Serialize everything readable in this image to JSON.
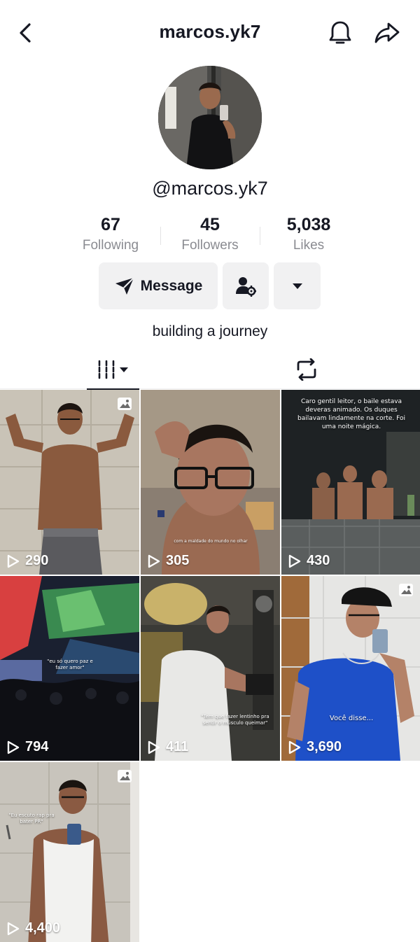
{
  "header": {
    "title": "marcos.yk7",
    "back_icon": "chevron-left-icon",
    "bell_icon": "bell-icon",
    "share_icon": "share-arrow-icon"
  },
  "profile": {
    "handle": "@marcos.yk7",
    "stats": [
      {
        "value": "67",
        "label": "Following"
      },
      {
        "value": "45",
        "label": "Followers"
      },
      {
        "value": "5,038",
        "label": "Likes"
      }
    ],
    "message_label": "Message",
    "bio": "building a journey"
  },
  "tabs": [
    {
      "name": "videos",
      "icon": "grid-icon",
      "active": true
    },
    {
      "name": "reposts",
      "icon": "repost-icon",
      "active": false
    }
  ],
  "videos": [
    {
      "views": "290",
      "photo": true,
      "caption": ""
    },
    {
      "views": "305",
      "photo": false,
      "caption": "com a maldade do mundo no olhar"
    },
    {
      "views": "430",
      "photo": false,
      "caption": "Caro gentil leitor, o baile estava deveras animado. Os duques bailavam lindamente na corte. Foi uma noite mágica."
    },
    {
      "views": "794",
      "photo": false,
      "caption": "\"eu só quero paz e fazer amor\""
    },
    {
      "views": "411",
      "photo": false,
      "caption": "\"Tem que fazer lentinho pra sentir o músculo queimar\""
    },
    {
      "views": "3,690",
      "photo": true,
      "caption": "Você disse..."
    },
    {
      "views": "4,400",
      "photo": true,
      "caption": "\"Eu escuto rap pra bater PR\""
    }
  ],
  "colors": {
    "text": "#161823",
    "secondary": "#8a8b91",
    "button_bg": "#f1f1f2"
  }
}
